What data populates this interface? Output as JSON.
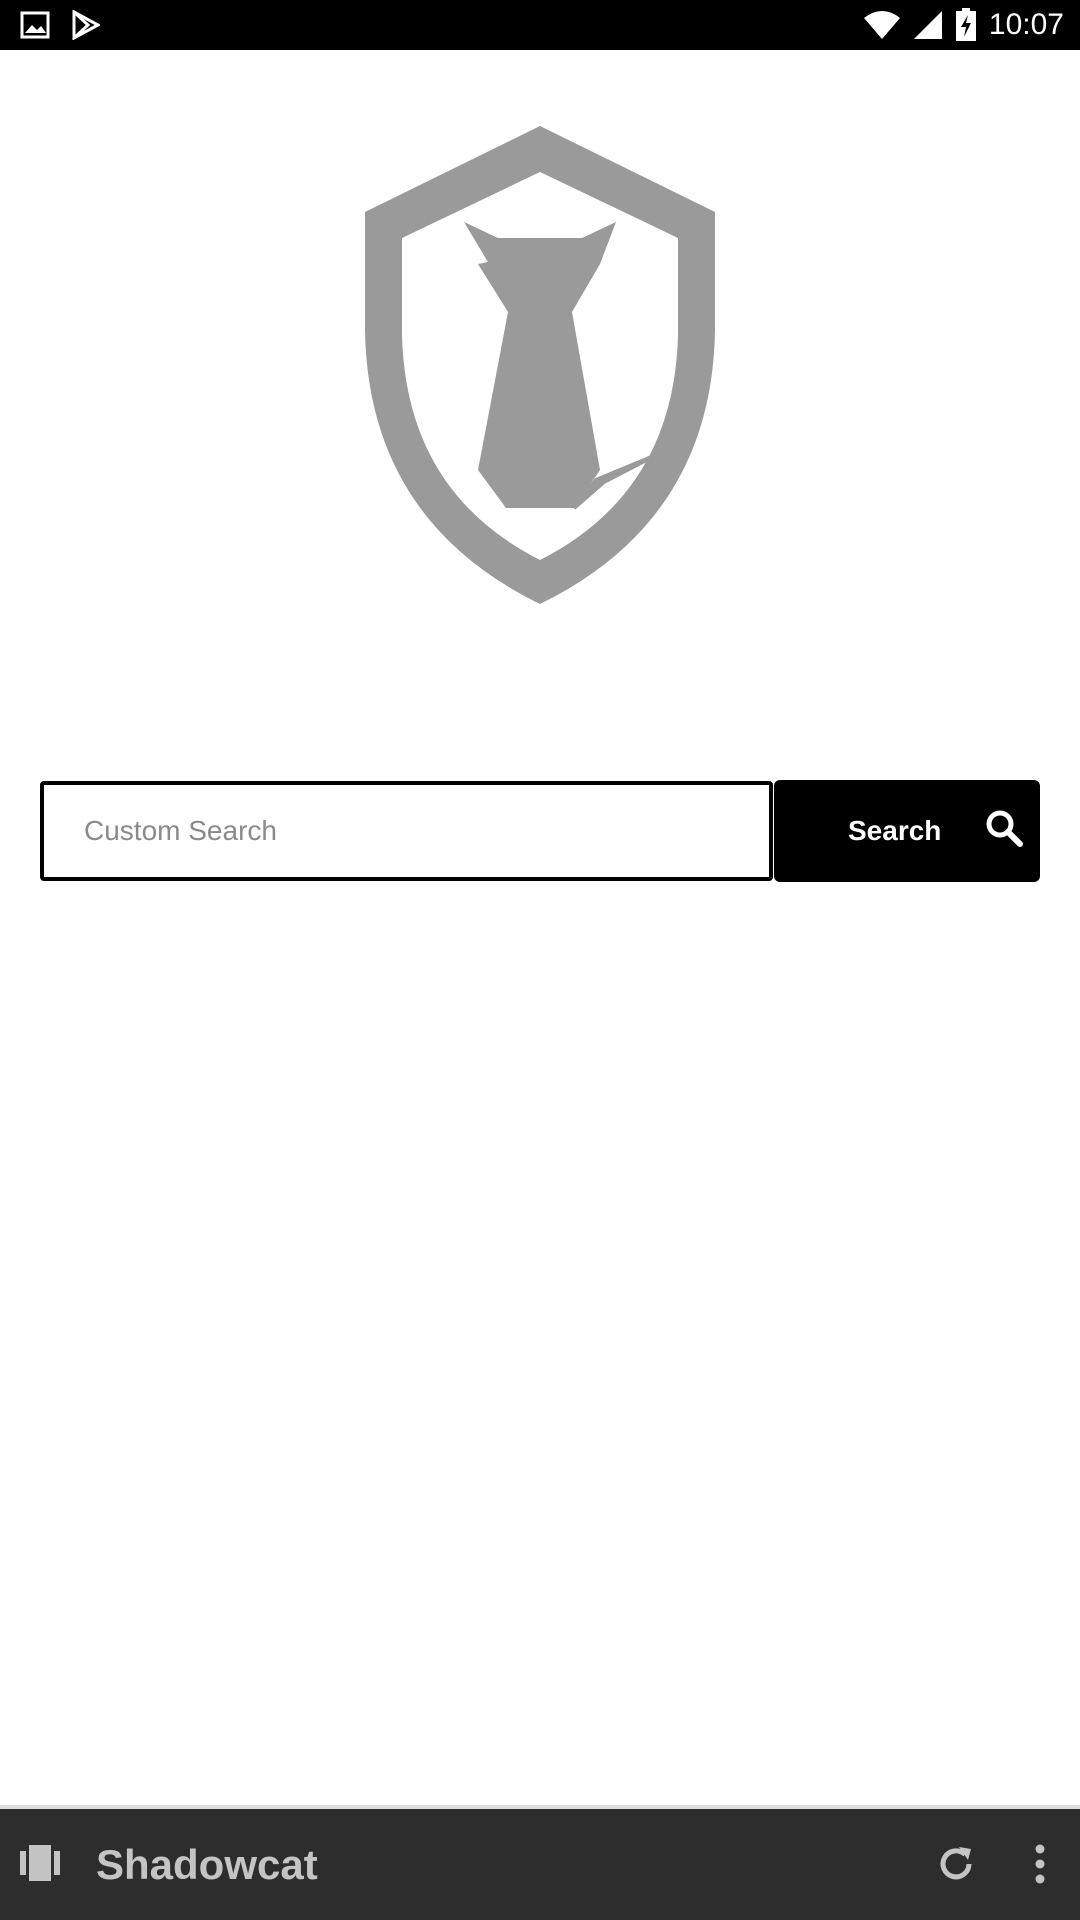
{
  "status_bar": {
    "time": "10:07",
    "left_icons": [
      "image-icon",
      "play-store-icon"
    ],
    "right_icons": [
      "wifi-icon",
      "signal-icon",
      "battery-charging-icon"
    ]
  },
  "logo": {
    "icon": "shield-cat-logo",
    "color": "#9a9a9a"
  },
  "search": {
    "placeholder": "Custom Search",
    "value": "",
    "button_label": "Search",
    "button_icon": "search-icon"
  },
  "bottom_bar": {
    "app_icon": "app-switch-icon",
    "title": "Shadowcat",
    "actions": [
      "refresh-icon",
      "more-vert-icon"
    ]
  },
  "colors": {
    "status_bar_bg": "#000000",
    "button_bg": "#000000",
    "bottom_bar_bg": "#2d2d2d",
    "bottom_bar_text": "#c4c4c4"
  }
}
